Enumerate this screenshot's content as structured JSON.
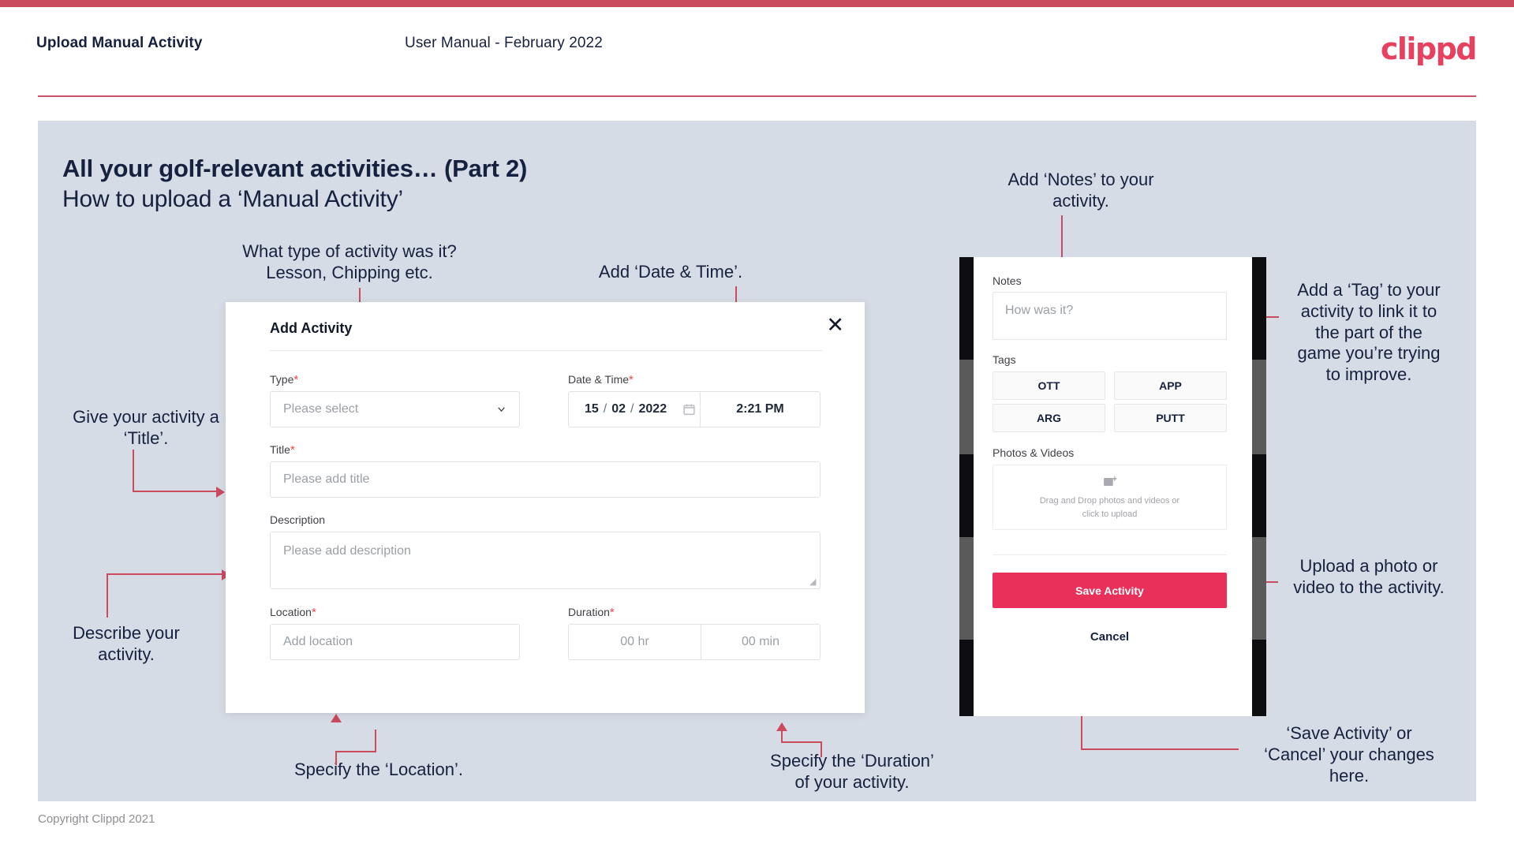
{
  "header": {
    "title": "Upload Manual Activity",
    "subtitle": "User Manual - February 2022",
    "logo": "clippd"
  },
  "slide": {
    "title": "All your golf-relevant activities… (Part 2)",
    "subtitle": "How to upload a ‘Manual Activity’"
  },
  "annotations": {
    "type": "What type of activity was it?\nLesson, Chipping etc.",
    "date_time": "Add ‘Date & Time’.",
    "title": "Give your activity a\n‘Title’.",
    "describe": "Describe your\nactivity.",
    "location": "Specify the ‘Location’.",
    "duration": "Specify the ‘Duration’\nof your activity.",
    "notes": "Add ‘Notes’ to your\nactivity.",
    "tags": "Add a ‘Tag’ to your\nactivity to link it to\nthe part of the\ngame you’re trying\nto improve.",
    "upload": "Upload a photo or\nvideo to the activity.",
    "save_cancel": "‘Save Activity’ or\n‘Cancel’ your changes\nhere."
  },
  "dialog": {
    "title": "Add Activity",
    "close_icon": "close-icon",
    "fields": {
      "type": {
        "label": "Type",
        "required": "*",
        "placeholder": "Please select"
      },
      "date_time": {
        "label": "Date & Time",
        "required": "*",
        "day": "15",
        "month": "02",
        "year": "2022",
        "separator": "/",
        "time": "2:21 PM"
      },
      "title": {
        "label": "Title",
        "required": "*",
        "placeholder": "Please add title"
      },
      "description": {
        "label": "Description",
        "required": "",
        "placeholder": "Please add description"
      },
      "location": {
        "label": "Location",
        "required": "*",
        "placeholder": "Add location"
      },
      "duration": {
        "label": "Duration",
        "required": "*",
        "hours_placeholder": "00 hr",
        "minutes_placeholder": "00 min"
      }
    }
  },
  "phone": {
    "notes": {
      "label": "Notes",
      "placeholder": "How was it?"
    },
    "tags": {
      "label": "Tags",
      "items": [
        "OTT",
        "APP",
        "ARG",
        "PUTT"
      ]
    },
    "photos": {
      "label": "Photos & Videos",
      "dropzone_line1": "Drag and Drop photos and videos or",
      "dropzone_line2": "click to upload",
      "icon": "add-image-icon"
    },
    "save_label": "Save Activity",
    "cancel_label": "Cancel"
  },
  "footer": {
    "copyright": "Copyright Clippd 2021"
  },
  "colors": {
    "brand_pink": "#e8405f",
    "accent_line": "#ca4a5e",
    "save_button": "#e8305a",
    "slide_bg": "#d6dce5",
    "text_navy": "#16213f"
  }
}
